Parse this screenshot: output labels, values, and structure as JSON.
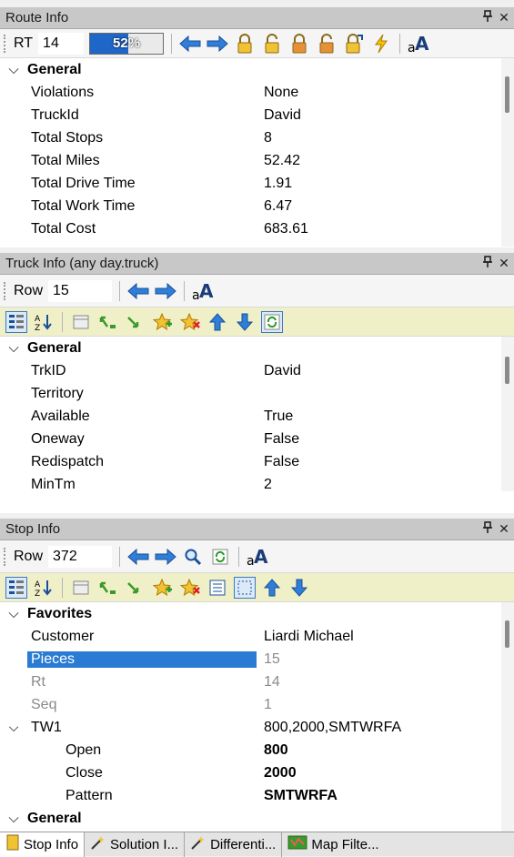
{
  "route_panel": {
    "title": "Route Info",
    "pin": "1",
    "close": "✕",
    "toolbar": {
      "label": "RT",
      "value": "14",
      "progress_text": "52%",
      "progress": 52
    },
    "category": "General",
    "rows": [
      {
        "k": "Violations",
        "v": "None"
      },
      {
        "k": "TruckId",
        "v": "David"
      },
      {
        "k": "Total Stops",
        "v": "8"
      },
      {
        "k": "Total Miles",
        "v": "52.42"
      },
      {
        "k": "Total Drive Time",
        "v": "1.91"
      },
      {
        "k": "Total Work Time",
        "v": "6.47"
      },
      {
        "k": "Total Cost",
        "v": "683.61"
      }
    ]
  },
  "truck_panel": {
    "title": "Truck Info (any day.truck)",
    "pin": "1",
    "close": "✕",
    "toolbar": {
      "label": "Row",
      "value": "15"
    },
    "category": "General",
    "rows": [
      {
        "k": "TrkID",
        "v": "David"
      },
      {
        "k": "Territory",
        "v": ""
      },
      {
        "k": "Available",
        "v": "True"
      },
      {
        "k": "Oneway",
        "v": "False"
      },
      {
        "k": "Redispatch",
        "v": "False"
      },
      {
        "k": "MinTm",
        "v": "2"
      }
    ]
  },
  "stop_panel": {
    "title": "Stop Info",
    "pin": "1",
    "close": "✕",
    "toolbar": {
      "label": "Row",
      "value": "372"
    },
    "category": "Favorites",
    "rows": [
      {
        "k": "Customer",
        "v": "Liardi Michael"
      },
      {
        "k": "Pieces",
        "v": "15"
      },
      {
        "k": "Rt",
        "v": "14"
      },
      {
        "k": "Seq",
        "v": "1"
      }
    ],
    "tw1": {
      "k": "TW1",
      "v": "800,2000,SMTWRFA"
    },
    "tw1_rows": [
      {
        "k": "Open",
        "v": "800"
      },
      {
        "k": "Close",
        "v": "2000"
      },
      {
        "k": "Pattern",
        "v": "SMTWRFA"
      }
    ],
    "category2": "General"
  },
  "tabs": [
    {
      "label": "Stop Info",
      "icon": "stop-info-icon"
    },
    {
      "label": "Solution I...",
      "icon": "solution-icon"
    },
    {
      "label": "Differenti...",
      "icon": "differential-icon"
    },
    {
      "label": "Map Filte...",
      "icon": "map-filter-icon"
    }
  ],
  "colors": {
    "accent": "#2a7bd3",
    "titlebar": "#c8c8c8",
    "command_bar": "#f0f0c8"
  }
}
